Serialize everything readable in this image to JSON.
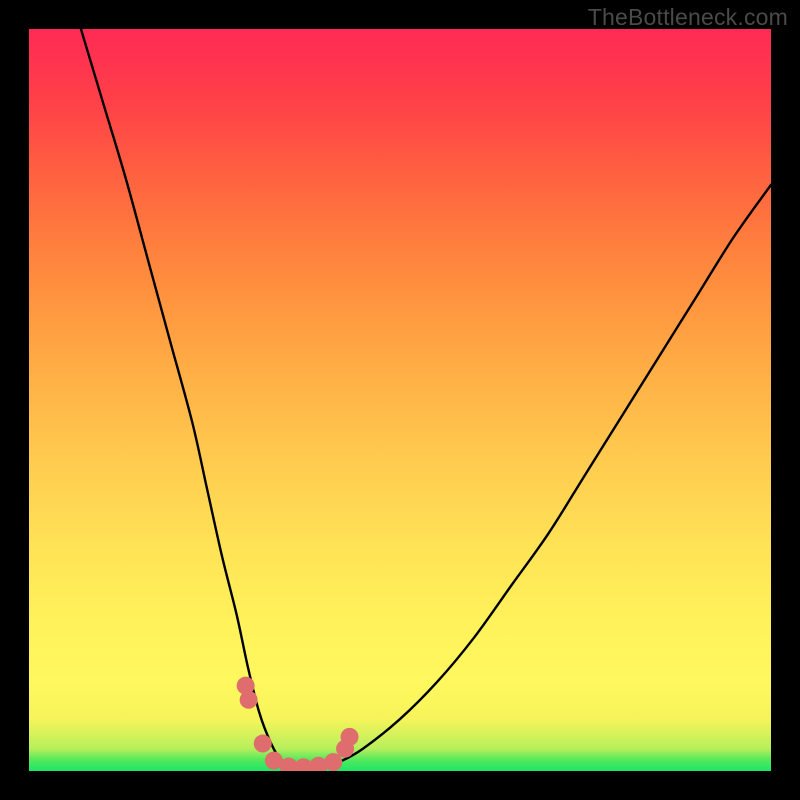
{
  "watermark": {
    "text": "TheBottleneck.com"
  },
  "colors": {
    "frame": "#000000",
    "curve_stroke": "#000000",
    "marker_fill": "#e06d6d",
    "gradient_stops": [
      "#1fe668",
      "#4fe85c",
      "#b7ef5c",
      "#f6f45a",
      "#fff85f",
      "#fff25a",
      "#ffe356",
      "#ffcf50",
      "#ffb848",
      "#ff9e41",
      "#ff823d",
      "#ff6240",
      "#ff4148",
      "#ff2a55"
    ]
  },
  "chart_data": {
    "type": "line",
    "title": "",
    "xlabel": "",
    "ylabel": "",
    "xlim": [
      0,
      100
    ],
    "ylim": [
      0,
      100
    ],
    "series": [
      {
        "name": "bottleneck-curve",
        "x": [
          7,
          10,
          13,
          16,
          19,
          22,
          24,
          26,
          28,
          29.5,
          31,
          32.5,
          34,
          36,
          38,
          40,
          42,
          45,
          50,
          55,
          60,
          65,
          70,
          75,
          80,
          85,
          90,
          95,
          100
        ],
        "values": [
          100,
          90,
          80,
          69,
          58,
          47,
          38,
          29,
          21,
          14,
          8,
          4,
          1.5,
          0.7,
          0.5,
          0.7,
          1.3,
          3,
          7,
          12,
          18,
          25,
          32,
          40,
          48,
          56,
          64,
          72,
          79
        ]
      }
    ],
    "markers": {
      "name": "highlighted-points",
      "x": [
        29.2,
        29.6,
        31.5,
        33.0,
        35.0,
        37.0,
        39.0,
        41.0,
        42.6,
        43.2
      ],
      "values": [
        11.5,
        9.6,
        3.7,
        1.4,
        0.6,
        0.5,
        0.7,
        1.2,
        3.0,
        4.6
      ]
    }
  }
}
